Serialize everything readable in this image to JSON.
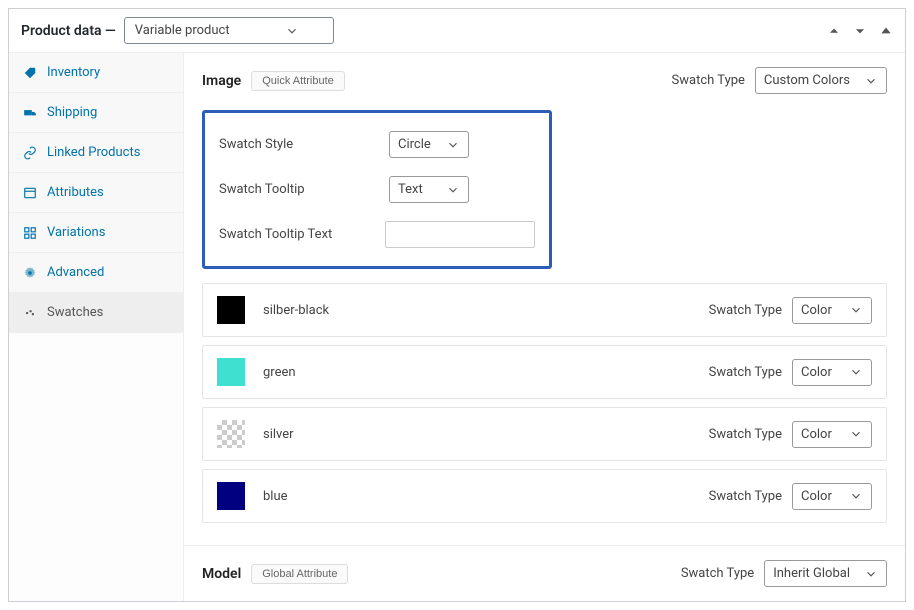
{
  "header": {
    "title": "Product data —",
    "product_type": "Variable product"
  },
  "sidebar": {
    "items": [
      {
        "label": "Inventory"
      },
      {
        "label": "Shipping"
      },
      {
        "label": "Linked Products"
      },
      {
        "label": "Attributes"
      },
      {
        "label": "Variations"
      },
      {
        "label": "Advanced"
      },
      {
        "label": "Swatches"
      }
    ]
  },
  "sections": {
    "image": {
      "title": "Image",
      "quick_btn": "Quick Attribute",
      "swatch_type_label": "Swatch Type",
      "swatch_type_value": "Custom Colors",
      "config": {
        "style_label": "Swatch Style",
        "style_value": "Circle",
        "tooltip_label": "Swatch Tooltip",
        "tooltip_value": "Text",
        "tooltip_text_label": "Swatch Tooltip Text",
        "tooltip_text_value": ""
      },
      "swatches": [
        {
          "name": "silber-black",
          "color": "#000000",
          "type_label": "Swatch Type",
          "type_value": "Color"
        },
        {
          "name": "green",
          "color": "#40e0d0",
          "type_label": "Swatch Type",
          "type_value": "Color"
        },
        {
          "name": "silver",
          "color": "checker",
          "type_label": "Swatch Type",
          "type_value": "Color"
        },
        {
          "name": "blue",
          "color": "#000080",
          "type_label": "Swatch Type",
          "type_value": "Color"
        }
      ]
    },
    "model": {
      "title": "Model",
      "global_btn": "Global Attribute",
      "swatch_type_label": "Swatch Type",
      "swatch_type_value": "Inherit Global"
    }
  }
}
